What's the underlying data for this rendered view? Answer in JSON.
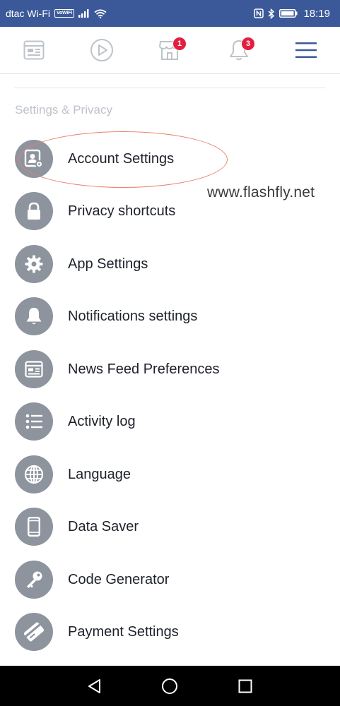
{
  "status_bar": {
    "carrier": "dtac Wi-Fi",
    "volte_badge": "VoWiFi",
    "time": "18:19"
  },
  "nav_tabs": [
    {
      "icon": "news-feed-icon"
    },
    {
      "icon": "watch-icon"
    },
    {
      "icon": "marketplace-icon",
      "badge": "1"
    },
    {
      "icon": "notifications-icon",
      "badge": "3"
    },
    {
      "icon": "menu-icon",
      "active": true
    }
  ],
  "section": {
    "title": "Settings & Privacy"
  },
  "items": [
    {
      "label": "Account Settings",
      "icon": "account-settings-icon"
    },
    {
      "label": "Privacy shortcuts",
      "icon": "lock-icon"
    },
    {
      "label": "App Settings",
      "icon": "gear-icon"
    },
    {
      "label": "Notifications settings",
      "icon": "bell-icon"
    },
    {
      "label": "News Feed Preferences",
      "icon": "news-feed-icon"
    },
    {
      "label": "Activity log",
      "icon": "list-icon"
    },
    {
      "label": "Language",
      "icon": "globe-icon"
    },
    {
      "label": "Data Saver",
      "icon": "phone-icon"
    },
    {
      "label": "Code Generator",
      "icon": "key-icon"
    },
    {
      "label": "Payment Settings",
      "icon": "credit-card-icon"
    }
  ],
  "watermark": "www.flashfly.net",
  "colors": {
    "status_bar": "#3b5998",
    "accent": "#3b5998",
    "icon_circle": "#8d949e",
    "badge": "#e41e3f",
    "annotation": "#e8806d"
  }
}
